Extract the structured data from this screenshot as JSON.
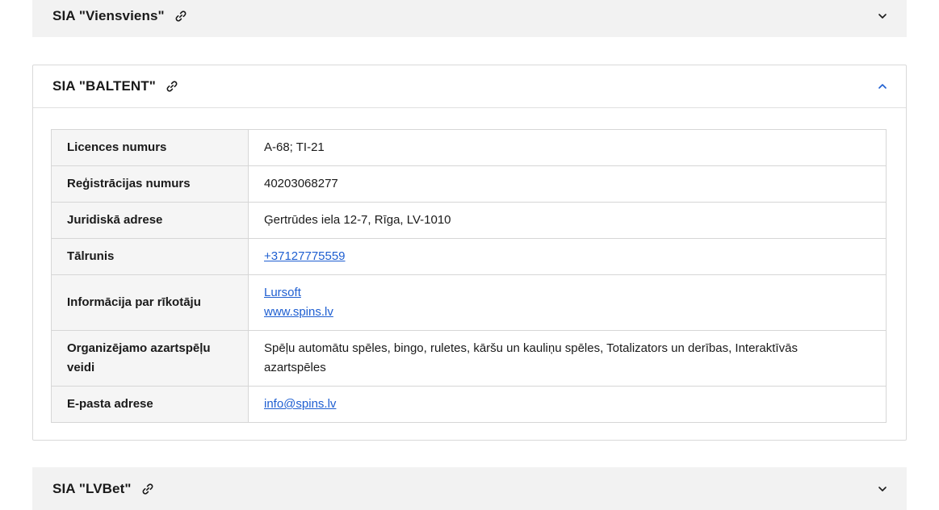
{
  "accordions": [
    {
      "title": "SIA \"Viensviens\"",
      "state": "collapsed"
    },
    {
      "title": "SIA \"BALTENT\"",
      "state": "expanded"
    },
    {
      "title": "SIA \"LVBet\"",
      "state": "collapsed"
    }
  ],
  "details": {
    "licence_label": "Licences numurs",
    "licence_value": "A-68; TI-21",
    "reg_label": "Reģistrācijas numurs",
    "reg_value": "40203068277",
    "address_label": "Juridiskā adrese",
    "address_value": "Ģertrūdes iela 12-7, Rīga, LV-1010",
    "phone_label": "Tālrunis",
    "phone_value": "+37127775559",
    "organizer_label": "Informācija par rīkotāju",
    "organizer_links": [
      "Lursoft",
      "www.spins.lv"
    ],
    "games_label": "Organizējamo azartspēļu veidi",
    "games_value": "Spēļu automātu spēles, bingo, ruletes, kāršu un kauliņu spēles, Totalizators un derības, Interaktīvās azartspēles",
    "email_label": "E-pasta adrese",
    "email_value": "info@spins.lv"
  },
  "colors": {
    "link": "#1f5fd1",
    "collapsed_bg": "#f2f2f2",
    "chevron_active": "#1f5fd1"
  },
  "icons": {
    "link": "link-icon",
    "collapsed": "chevron-down-icon",
    "expanded": "chevron-up-icon"
  }
}
